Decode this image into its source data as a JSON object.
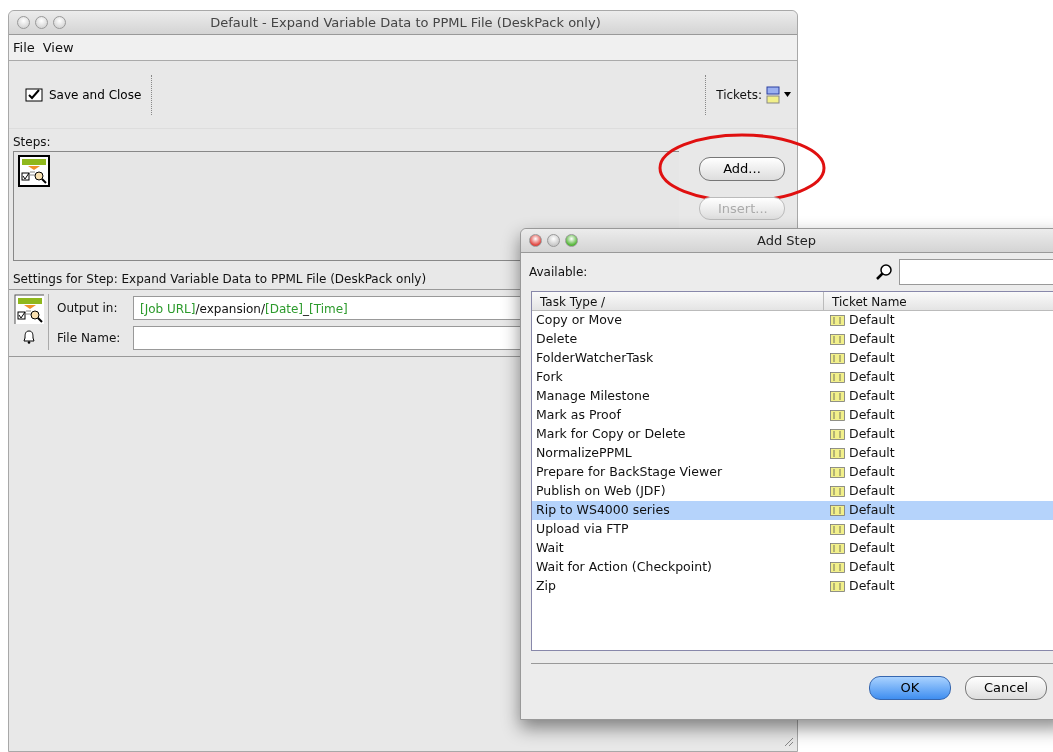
{
  "main_window": {
    "title": "Default - Expand Variable Data to PPML File (DeskPack only)",
    "active": false,
    "menu": [
      "File",
      "View"
    ],
    "toolbar": {
      "save_button": "Save and Close",
      "tickets_label": "Tickets:"
    },
    "steps": {
      "label": "Steps:",
      "buttons": [
        {
          "label": "Add...",
          "disabled": false,
          "circled": true
        },
        {
          "label": "Insert...",
          "disabled": true,
          "circled": false
        }
      ]
    },
    "settings": {
      "title": "Settings for Step: Expand Variable Data to PPML File (DeskPack only)",
      "fields": [
        {
          "label": "Output in:",
          "segments": [
            {
              "text": "[Job URL]",
              "kind": "variable"
            },
            {
              "text": "/expansion/",
              "kind": "literal"
            },
            {
              "text": "[Date]",
              "kind": "variable"
            },
            {
              "text": "_",
              "kind": "literal"
            },
            {
              "text": "[Time]",
              "kind": "variable"
            }
          ]
        },
        {
          "label": "File Name:"
        }
      ]
    }
  },
  "dialog": {
    "title": "Add Step",
    "active": true,
    "available_label": "Available:",
    "columns": [
      "Task Type /",
      "Ticket Name"
    ],
    "rows": [
      {
        "task": "Copy or Move",
        "ticket": "Default",
        "selected": false
      },
      {
        "task": "Delete",
        "ticket": "Default",
        "selected": false
      },
      {
        "task": "FolderWatcherTask",
        "ticket": "Default",
        "selected": false
      },
      {
        "task": "Fork",
        "ticket": "Default",
        "selected": false
      },
      {
        "task": "Manage Milestone",
        "ticket": "Default",
        "selected": false
      },
      {
        "task": "Mark as Proof",
        "ticket": "Default",
        "selected": false
      },
      {
        "task": "Mark for Copy or Delete",
        "ticket": "Default",
        "selected": false
      },
      {
        "task": "NormalizePPML",
        "ticket": "Default",
        "selected": false
      },
      {
        "task": "Prepare for BackStage Viewer",
        "ticket": "Default",
        "selected": false
      },
      {
        "task": "Publish on Web (JDF)",
        "ticket": "Default",
        "selected": false
      },
      {
        "task": "Rip to WS4000 series",
        "ticket": "Default",
        "selected": true
      },
      {
        "task": "Upload via FTP",
        "ticket": "Default",
        "selected": false
      },
      {
        "task": "Wait",
        "ticket": "Default",
        "selected": false
      },
      {
        "task": "Wait for Action (Checkpoint)",
        "ticket": "Default",
        "selected": false
      },
      {
        "task": "Zip",
        "ticket": "Default",
        "selected": false
      }
    ],
    "buttons": [
      {
        "label": "OK",
        "default": true
      },
      {
        "label": "Cancel",
        "default": false
      }
    ]
  }
}
